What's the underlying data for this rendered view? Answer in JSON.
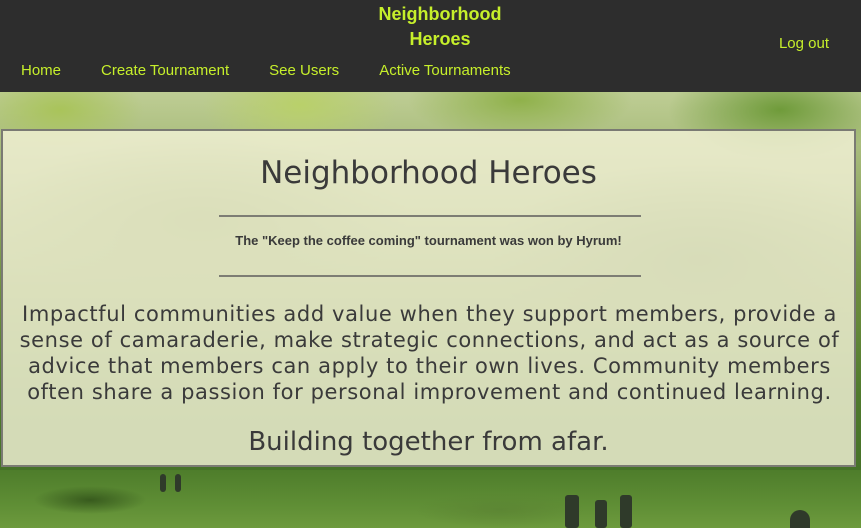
{
  "brand": {
    "line1": "Neighborhood",
    "line2": "Heroes"
  },
  "nav": {
    "items": [
      {
        "label": "Home"
      },
      {
        "label": "Create Tournament"
      },
      {
        "label": "See Users"
      },
      {
        "label": "Active Tournaments"
      }
    ],
    "logout_label": "Log out"
  },
  "main": {
    "title": "Neighborhood Heroes",
    "winner_text": "The \"Keep the coffee coming\" tournament was won by Hyrum!",
    "description": "Impactful communities add value when they support members, provide a sense of camaraderie, make strategic connections, and act as a source of advice that members can apply to their own lives. Community members often share a passion for personal improvement and continued learning.",
    "tagline": "Building together from afar."
  },
  "colors": {
    "nav_bg": "#2d2d2d",
    "accent": "#c6ef2b",
    "card_bg": "#f3f2d7",
    "text": "#3a3a3a"
  }
}
